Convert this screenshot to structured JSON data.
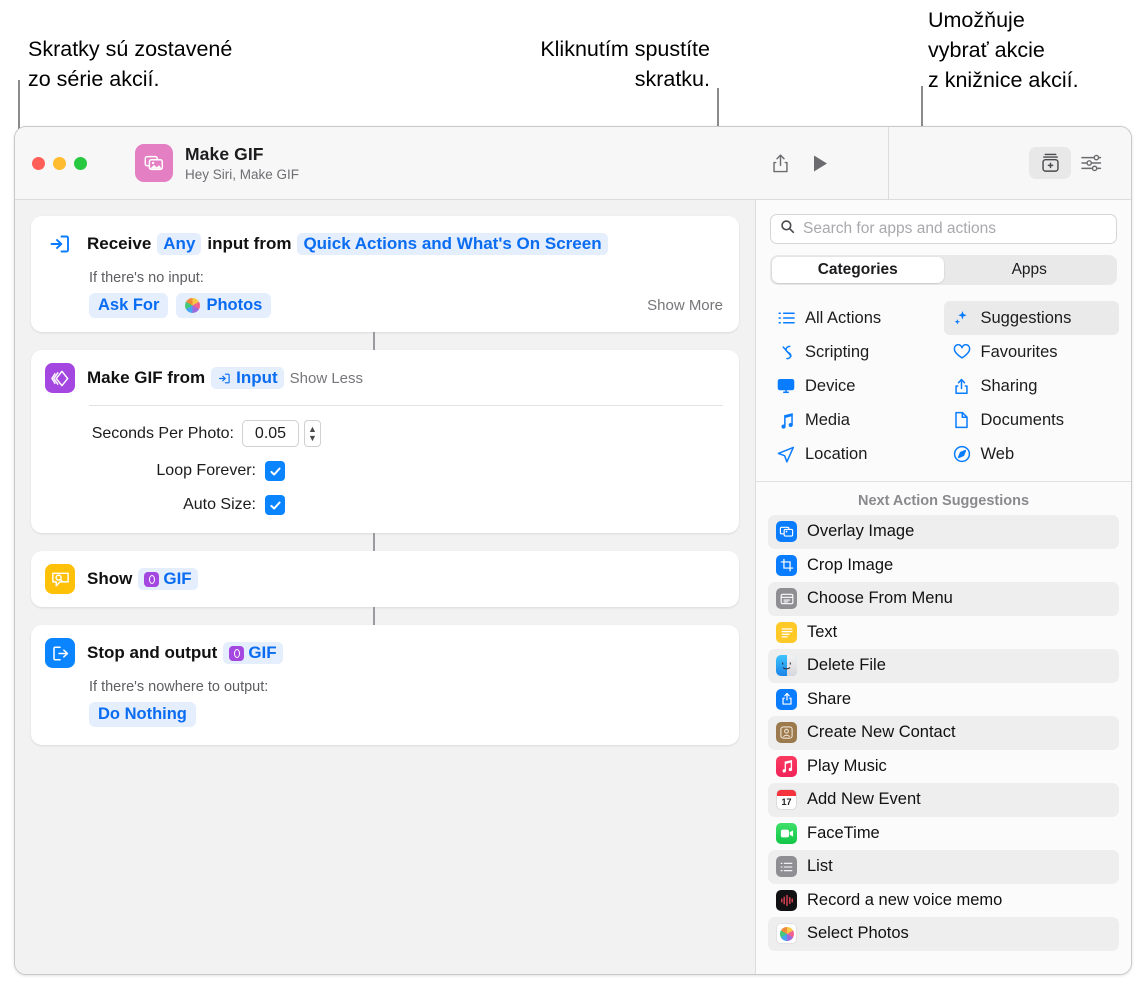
{
  "callouts": {
    "left": "Skratky sú zostavené\nzo série akcií.",
    "middle": "Kliknutím spustíte\nskratku.",
    "right": "Umožňuje\nvybrať akcie\nz knižnice akcií."
  },
  "window": {
    "title": "Make GIF",
    "subtitle": "Hey Siri, Make GIF",
    "toolbar": {
      "share_label": "share-icon",
      "run_label": "play-icon",
      "library_label": "action-library-icon",
      "details_label": "shortcut-details-icon"
    }
  },
  "actions": [
    {
      "id": "receive",
      "title_prefix": "Receive",
      "token_any": "Any",
      "title_mid": "input from",
      "token_source": "Quick Actions and What's On Screen",
      "sub_label": "If there's no input:",
      "chips": [
        "Ask For",
        "Photos"
      ],
      "toggle": "Show More"
    },
    {
      "id": "make-gif",
      "title_prefix": "Make GIF from",
      "token_input": "Input",
      "toggle": "Show Less",
      "params": [
        {
          "label": "Seconds Per Photo:",
          "type": "stepper",
          "value": "0.05"
        },
        {
          "label": "Loop Forever:",
          "type": "checkbox",
          "value": "checked"
        },
        {
          "label": "Auto Size:",
          "type": "checkbox",
          "value": "checked"
        }
      ]
    },
    {
      "id": "show",
      "title_prefix": "Show",
      "token_var": "GIF"
    },
    {
      "id": "stop-and-output",
      "title_prefix": "Stop and output",
      "token_var": "GIF",
      "sub_label": "If there's nowhere to output:",
      "chips": [
        "Do Nothing"
      ]
    }
  ],
  "library": {
    "search_placeholder": "Search for apps and actions",
    "segments": [
      {
        "label": "Categories",
        "active": true
      },
      {
        "label": "Apps",
        "active": false
      }
    ],
    "categories": [
      {
        "label": "All Actions",
        "icon": "list-bullet-icon",
        "selected": false
      },
      {
        "label": "Suggestions",
        "icon": "sparkles-icon",
        "selected": true
      },
      {
        "label": "Scripting",
        "icon": "script-icon",
        "selected": false
      },
      {
        "label": "Favourites",
        "icon": "heart-icon",
        "selected": false
      },
      {
        "label": "Device",
        "icon": "display-icon",
        "selected": false
      },
      {
        "label": "Sharing",
        "icon": "share-up-icon",
        "selected": false
      },
      {
        "label": "Media",
        "icon": "music-note-icon",
        "selected": false
      },
      {
        "label": "Documents",
        "icon": "document-icon",
        "selected": false
      },
      {
        "label": "Location",
        "icon": "paper-plane-icon",
        "selected": false
      },
      {
        "label": "Web",
        "icon": "safari-compass-icon",
        "selected": false
      }
    ],
    "suggestions_header": "Next Action Suggestions",
    "suggestions": [
      {
        "label": "Overlay Image",
        "icon": "overlay-image-icon"
      },
      {
        "label": "Crop Image",
        "icon": "crop-image-icon"
      },
      {
        "label": "Choose From Menu",
        "icon": "menu-icon"
      },
      {
        "label": "Text",
        "icon": "text-icon"
      },
      {
        "label": "Delete File",
        "icon": "finder-icon"
      },
      {
        "label": "Share",
        "icon": "share-icon"
      },
      {
        "label": "Create New Contact",
        "icon": "contacts-icon"
      },
      {
        "label": "Play Music",
        "icon": "music-app-icon"
      },
      {
        "label": "Add New Event",
        "icon": "calendar-icon"
      },
      {
        "label": "FaceTime",
        "icon": "facetime-icon"
      },
      {
        "label": "List",
        "icon": "list-icon"
      },
      {
        "label": "Record a new voice memo",
        "icon": "voice-memos-icon"
      },
      {
        "label": "Select Photos",
        "icon": "photos-icon"
      }
    ]
  },
  "colors": {
    "accent_blue": "#0a7cff",
    "token_bg": "#e4eefd",
    "purple": "#a347e0",
    "yellow": "#ffc107",
    "app_pink": "#e57fc4"
  }
}
